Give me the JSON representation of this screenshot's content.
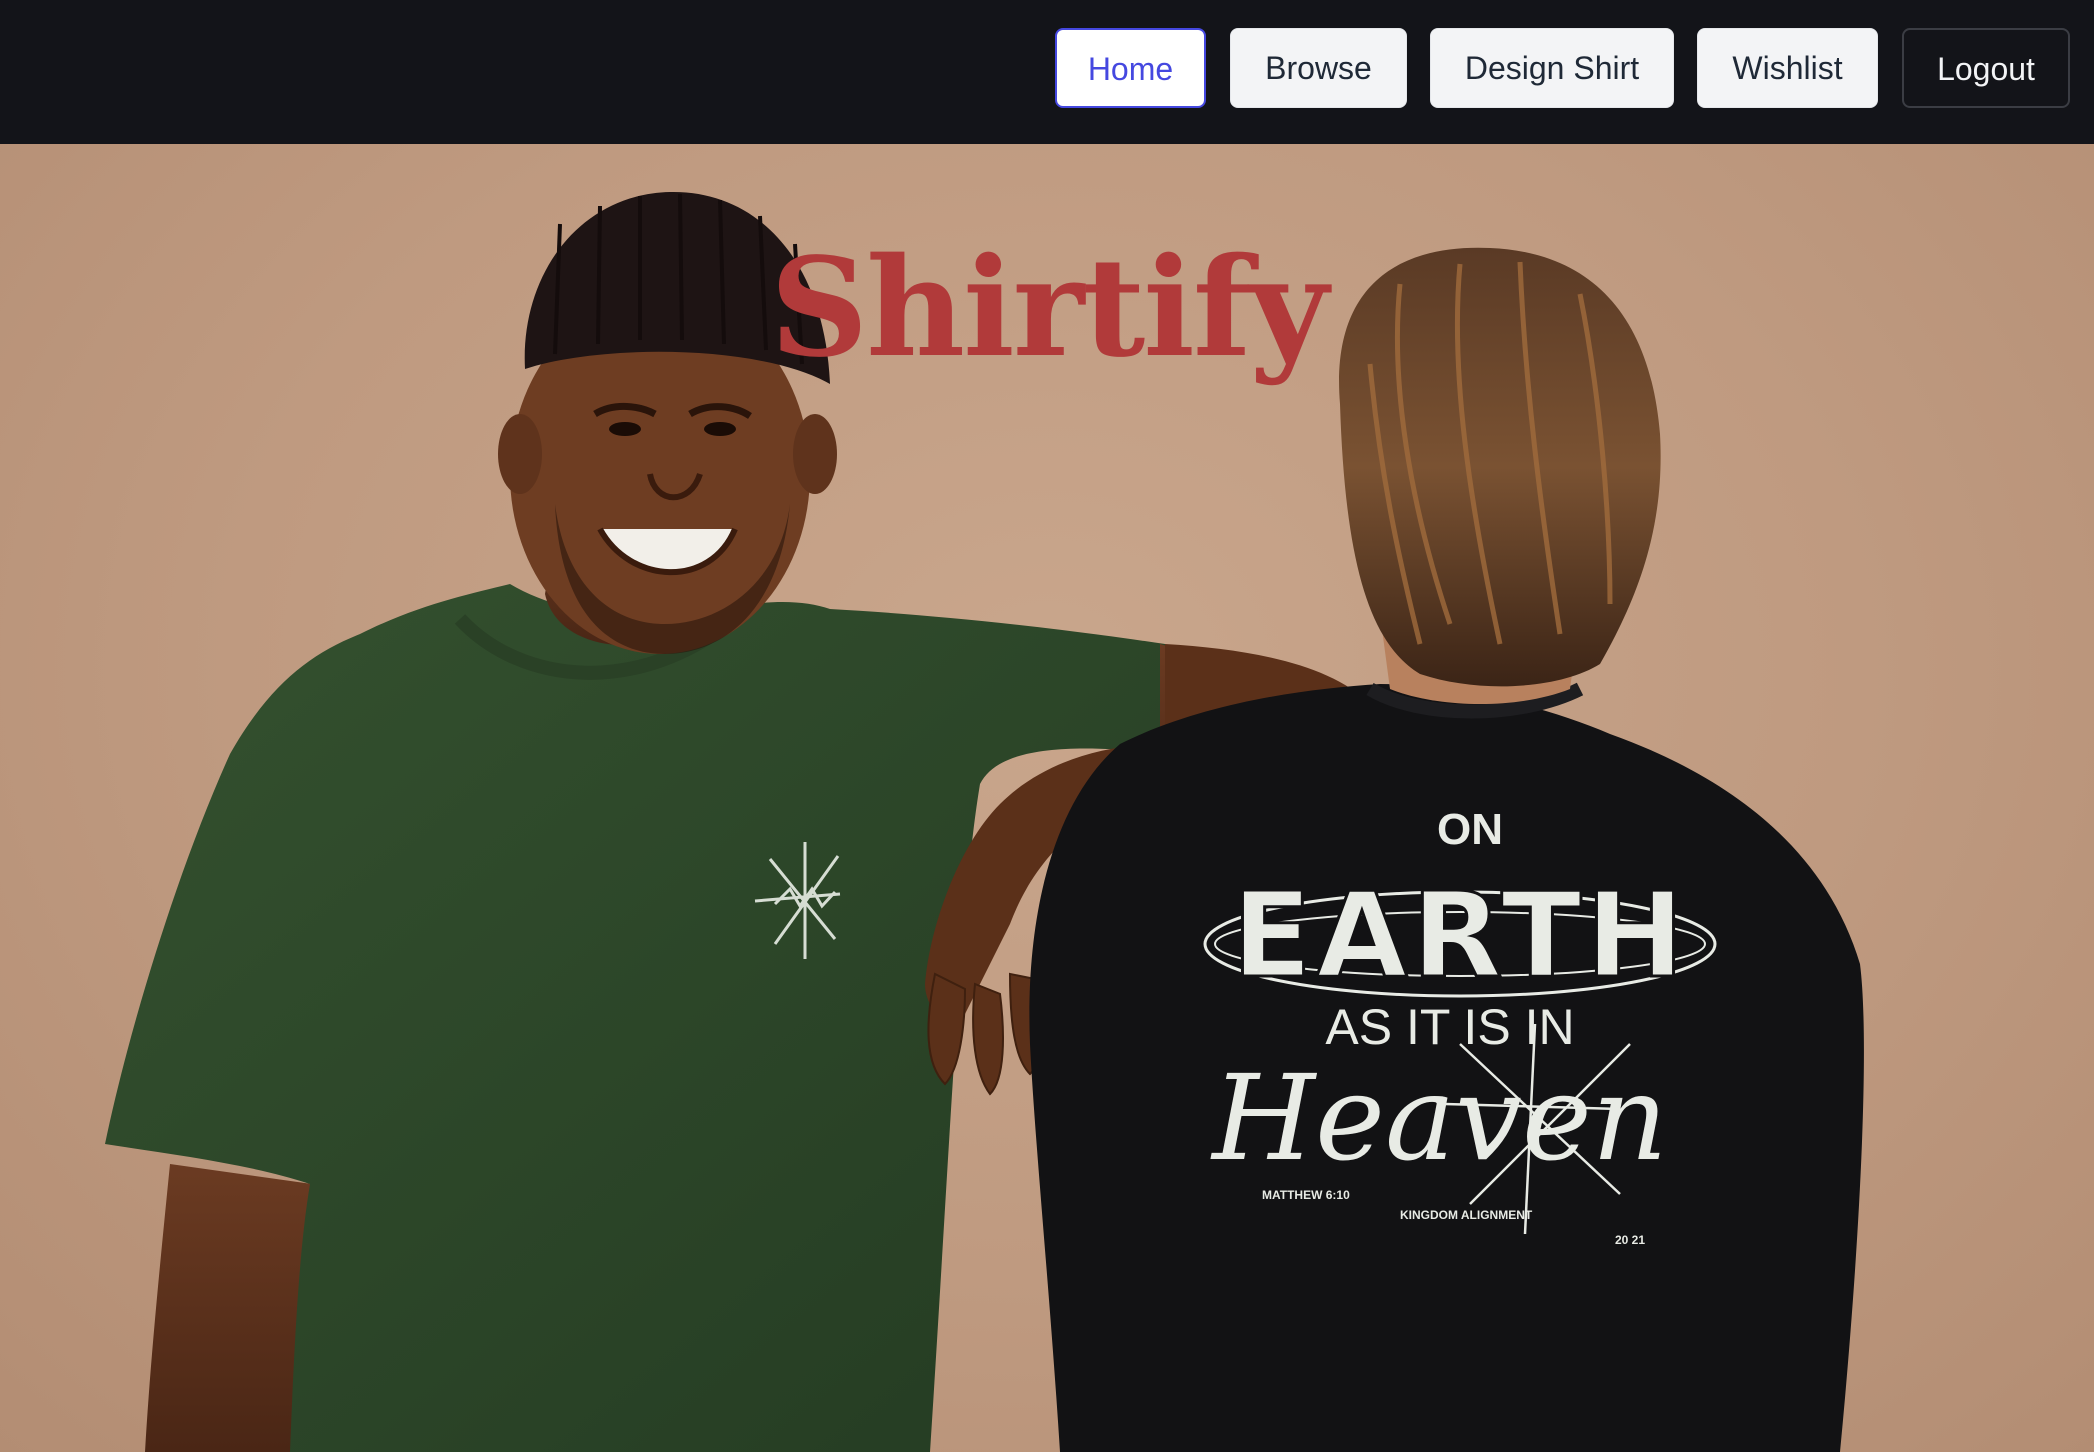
{
  "nav": {
    "home_label": "Home",
    "browse_label": "Browse",
    "design_label": "Design Shirt",
    "wishlist_label": "Wishlist",
    "logout_label": "Logout",
    "active_item": "Home"
  },
  "hero": {
    "brand_title": "Shirtify",
    "image_alt": "Two models wearing t-shirts",
    "shirt_print": {
      "line1": "ON",
      "line2": "EARTH",
      "line3": "AS IT IS IN",
      "line4": "Heaven",
      "foot_left": "MATTHEW 6:10",
      "foot_center": "KINGDOM ALIGNMENT",
      "foot_right": "20 21"
    }
  },
  "colors": {
    "nav_bg": "#131419",
    "active_accent": "#4548e0",
    "brand_red": "#b13a3a",
    "backdrop": "#c19d83"
  }
}
